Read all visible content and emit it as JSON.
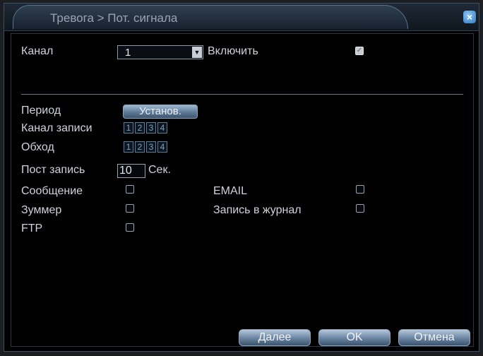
{
  "window": {
    "title": "Тревога > Пот. сигнала",
    "close_symbol": "×"
  },
  "channel": {
    "label": "Канал",
    "value": "1",
    "dropdown_symbol": "▼"
  },
  "enable": {
    "label": "Включить",
    "checked": true,
    "check_symbol": "✓"
  },
  "period": {
    "label": "Период",
    "button_label": "Установ."
  },
  "record_channel": {
    "label": "Канал записи",
    "channels": [
      "1",
      "2",
      "3",
      "4"
    ]
  },
  "tour": {
    "label": "Обход",
    "channels": [
      "1",
      "2",
      "3",
      "4"
    ]
  },
  "post_record": {
    "label": "Пост запись",
    "value": "10",
    "unit": "Сек."
  },
  "options": {
    "message": {
      "label": "Сообщение",
      "checked": false
    },
    "email": {
      "label": "EMAIL",
      "checked": false
    },
    "buzzer": {
      "label": "Зуммер",
      "checked": false
    },
    "log": {
      "label": "Запись в журнал",
      "checked": false
    },
    "ftp": {
      "label": "FTP",
      "checked": false
    }
  },
  "footer": {
    "next_label": "Далее",
    "ok_label": "OK",
    "cancel_label": "Отмена"
  },
  "colors": {
    "background": "#000000",
    "title_text": "#9aa4b0",
    "label_text": "#cfd3da",
    "button_accent": "#6f89a6"
  }
}
